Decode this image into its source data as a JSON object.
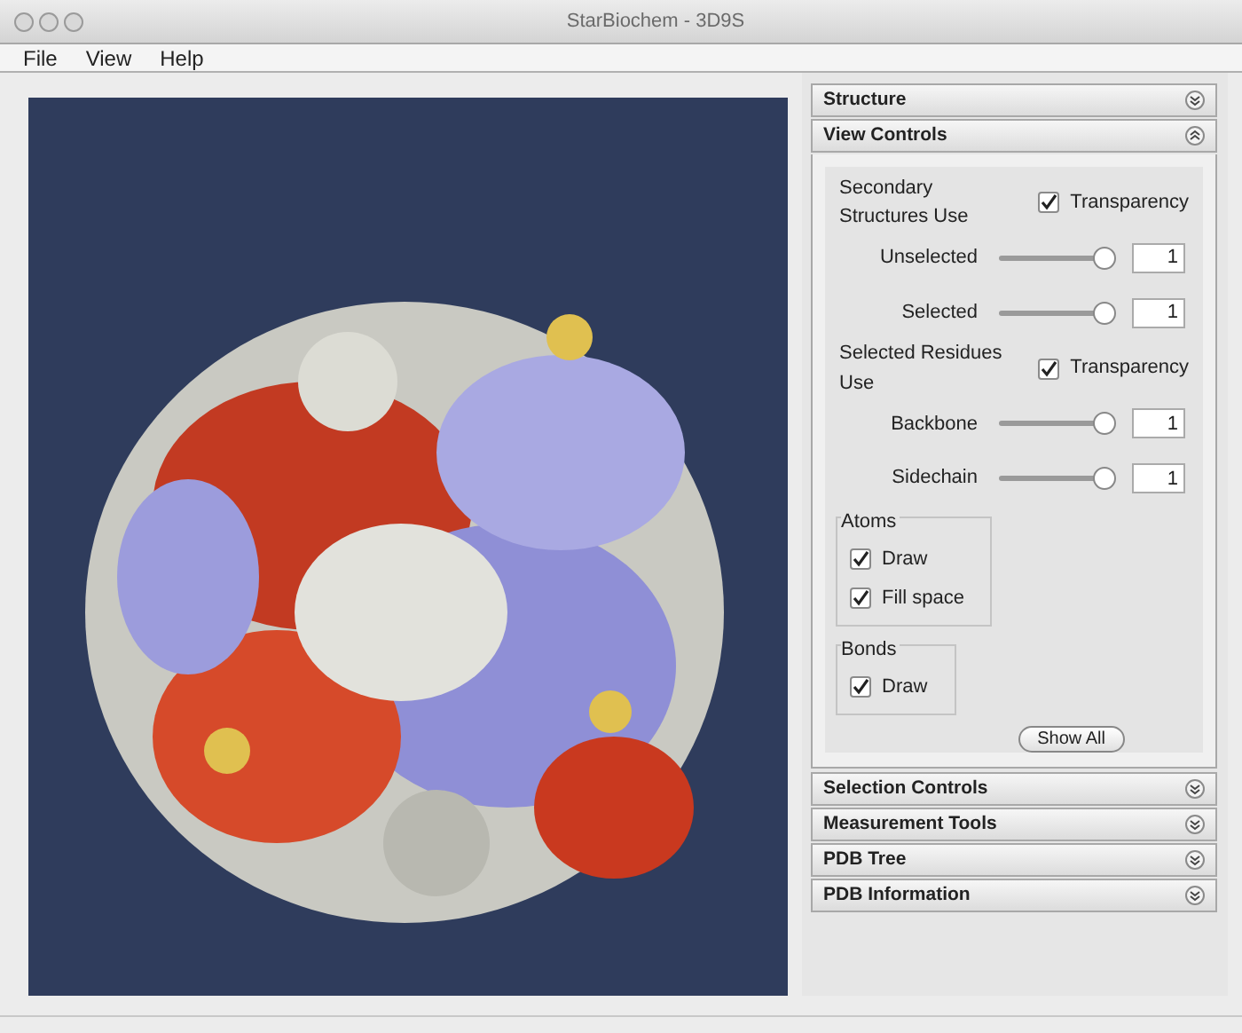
{
  "window": {
    "title": "StarBiochem - 3D9S"
  },
  "menu": [
    "File",
    "View",
    "Help"
  ],
  "panels": [
    {
      "title": "Structure",
      "expanded": false
    },
    {
      "title": "View Controls",
      "expanded": true,
      "controls": [
        {
          "kind": "toggle",
          "label": "Secondary Structures Use",
          "option": "Transparency",
          "checked": true
        },
        {
          "kind": "slider",
          "label": "Unselected",
          "level": 1,
          "value": "1"
        },
        {
          "kind": "slider",
          "label": "Selected",
          "level": 1,
          "value": "1"
        },
        {
          "kind": "toggle",
          "label": "Selected Residues Use",
          "option": "Transparency",
          "checked": true
        },
        {
          "kind": "slider",
          "label": "Backbone",
          "level": 1,
          "value": "1"
        },
        {
          "kind": "slider",
          "label": "Sidechain",
          "level": 1,
          "value": "1"
        },
        {
          "kind": "group",
          "title": "Atoms",
          "options": [
            {
              "label": "Draw",
              "checked": true
            },
            {
              "label": "Fill space",
              "checked": true
            }
          ]
        },
        {
          "kind": "group",
          "title": "Bonds",
          "options": [
            {
              "label": "Draw",
              "checked": true
            }
          ]
        },
        {
          "kind": "button",
          "label": "Show All"
        }
      ]
    },
    {
      "title": "Selection Controls",
      "expanded": false
    },
    {
      "title": "Measurement Tools",
      "expanded": false
    },
    {
      "title": "PDB Tree",
      "expanded": false
    },
    {
      "title": "PDB Information",
      "expanded": false
    }
  ]
}
